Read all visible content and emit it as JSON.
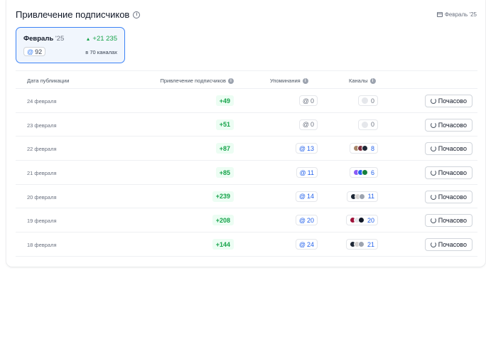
{
  "header": {
    "title": "Привлечение подписчиков",
    "date_filter": "Февраль '25"
  },
  "period_card": {
    "month": "Февраль",
    "year": "'25",
    "delta": "+21 235",
    "mentions": "92",
    "channels_text": "в 70 каналах"
  },
  "table": {
    "headers": {
      "date": "Дата публикации",
      "subscribers": "Привлечение подписчиков",
      "mentions": "Упоминания",
      "channels": "Каналы"
    },
    "action_label": "Почасово",
    "rows": [
      {
        "date": "24 февраля",
        "subs": "+49",
        "mentions": "0",
        "channels": "0",
        "avatars": []
      },
      {
        "date": "23 февраля",
        "subs": "+51",
        "mentions": "0",
        "channels": "0",
        "avatars": []
      },
      {
        "date": "22 февраля",
        "subs": "+87",
        "mentions": "13",
        "channels": "8",
        "avatars": [
          "#a8876a",
          "#7c2d3d",
          "#1f2937"
        ]
      },
      {
        "date": "21 февраля",
        "subs": "+85",
        "mentions": "11",
        "channels": "6",
        "avatars": [
          "#8b5cf6",
          "#2563eb",
          "#15803d"
        ]
      },
      {
        "date": "20 февраля",
        "subs": "+239",
        "mentions": "14",
        "channels": "11",
        "avatars": [
          "#1f2937",
          "#d6d3d1",
          "#9ca3af"
        ]
      },
      {
        "date": "19 февраля",
        "subs": "+208",
        "mentions": "20",
        "channels": "20",
        "avatars": [
          "#9f1239",
          "#e5e7eb",
          "#111827"
        ]
      },
      {
        "date": "18 февраля",
        "subs": "+144",
        "mentions": "24",
        "channels": "21",
        "avatars": [
          "#1f2937",
          "#d6d3d1",
          "#9ca3af"
        ]
      }
    ]
  },
  "colors": {
    "accent": "#3b82f6",
    "positive": "#16a34a",
    "positive_bg": "#ecfdf3",
    "mention_blue": "#2563eb"
  },
  "icons": {
    "title_info": "info-icon",
    "date_filter": "calendar-icon",
    "delta": "arrow-up-icon",
    "mention": "at-icon",
    "hourly": "refresh-icon"
  }
}
